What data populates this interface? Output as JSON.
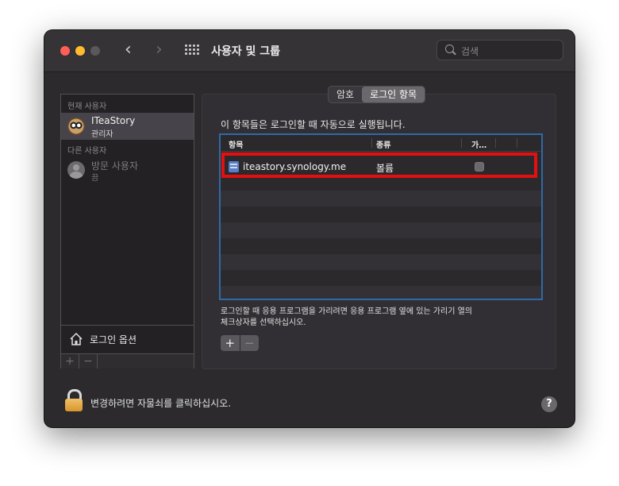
{
  "window": {
    "title": "사용자 및 그룹",
    "nav_back": "‹",
    "nav_forward": "›"
  },
  "search": {
    "placeholder": "검색"
  },
  "sidebar": {
    "current_users_label": "현재 사용자",
    "other_users_label": "다른 사용자",
    "users": [
      {
        "name": "ITeaStory",
        "role": "관리자",
        "avatar": "owl-avatar",
        "selected": true
      },
      {
        "name": "방문 사용자",
        "role": "끔",
        "avatar": "guest-avatar",
        "selected": false
      }
    ],
    "login_options_label": "로그인 옵션",
    "add_label": "+",
    "remove_label": "−"
  },
  "tabs": [
    {
      "label": "암호",
      "active": false
    },
    {
      "label": "로그인 항목",
      "active": true
    }
  ],
  "login_items": {
    "description": "이 항목들은 로그인할 때 자동으로 실행됩니다.",
    "columns": [
      "항목",
      "종류",
      "가…"
    ],
    "rows": [
      {
        "item": "iteastory.synology.me",
        "kind": "볼륨",
        "hide": false,
        "icon": "volume-icon"
      }
    ],
    "hint_line1": "로그인할 때 응용 프로그램을 가리려면 응용 프로그램 옆에 있는 가리기 열의",
    "hint_line2": "체크상자를 선택하십시오.",
    "add_label": "+",
    "remove_label": "−",
    "highlight_color": "#e21010"
  },
  "footer": {
    "lock_text": "변경하려면 자물쇠를 클릭하십시오.",
    "help_label": "?"
  },
  "colors": {
    "close": "#fe5f57",
    "minimize": "#febc2e",
    "table_focus": "#2f6aa6"
  }
}
